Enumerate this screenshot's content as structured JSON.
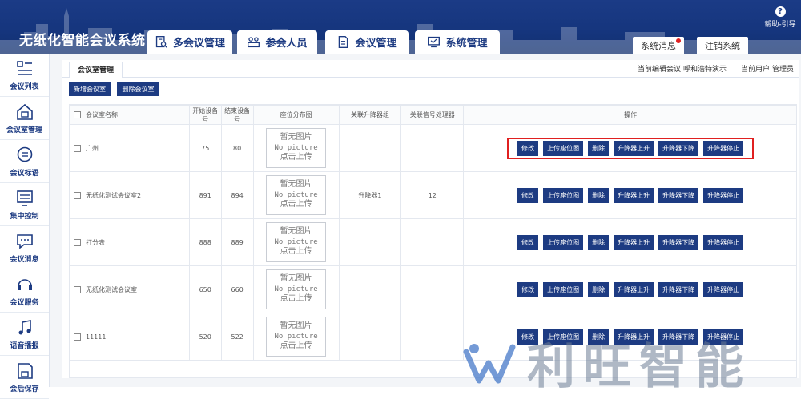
{
  "header": {
    "app_title": "无纸化智能会议系统",
    "tabs": [
      {
        "label": "多会议管理",
        "icon": "document-search-icon"
      },
      {
        "label": "参会人员",
        "icon": "people-group-icon"
      },
      {
        "label": "会议管理",
        "icon": "meeting-doc-icon"
      },
      {
        "label": "系统管理",
        "icon": "system-monitor-icon"
      }
    ],
    "system_message": "系统消息",
    "logout": "注销系统",
    "help": "帮助-引导"
  },
  "sidebar": {
    "items": [
      {
        "label": "会议列表",
        "icon": "list-icon"
      },
      {
        "label": "会议室管理",
        "icon": "meeting-room-icon"
      },
      {
        "label": "会议标语",
        "icon": "chat-bubble-icon"
      },
      {
        "label": "集中控制",
        "icon": "control-panel-icon"
      },
      {
        "label": "会议消息",
        "icon": "message-icon"
      },
      {
        "label": "会议服务",
        "icon": "headset-icon"
      },
      {
        "label": "语音播报",
        "icon": "music-note-icon"
      },
      {
        "label": "会后保存",
        "icon": "save-icon"
      }
    ]
  },
  "page": {
    "tab_label": "会议室管理",
    "current_meeting": "当前编辑会议:呼和浩特演示",
    "current_user": "当前用户:管理员",
    "add_button": "新增会议室",
    "delete_button": "删除会议室"
  },
  "table": {
    "columns": [
      "会议室名称",
      "开始设备号",
      "结束设备号",
      "座位分布图",
      "关联升降器组",
      "关联信号处理器",
      "操作"
    ],
    "no_picture": [
      "暂无图片",
      "No picture",
      "点击上传"
    ],
    "actions": [
      "修改",
      "上传座位图",
      "删除",
      "升降器上升",
      "升降器下降",
      "升降器停止"
    ],
    "rows": [
      {
        "name": "广州",
        "start": "75",
        "end": "80",
        "lifter_group": "",
        "signal_processor": ""
      },
      {
        "name": "无纸化测试会议室2",
        "start": "891",
        "end": "894",
        "lifter_group": "升降器1",
        "signal_processor": "12"
      },
      {
        "name": "打分表",
        "start": "888",
        "end": "889",
        "lifter_group": "",
        "signal_processor": ""
      },
      {
        "name": "无纸化测试会议室",
        "start": "650",
        "end": "660",
        "lifter_group": "",
        "signal_processor": ""
      },
      {
        "name": "11111",
        "start": "520",
        "end": "522",
        "lifter_group": "",
        "signal_processor": ""
      }
    ]
  },
  "watermark": {
    "text": "利旺智能",
    "logo": "brand-logo-icon"
  },
  "colors": {
    "primary": "#1d3b82",
    "highlight": "#e02020",
    "header_bg": "#15357d"
  }
}
